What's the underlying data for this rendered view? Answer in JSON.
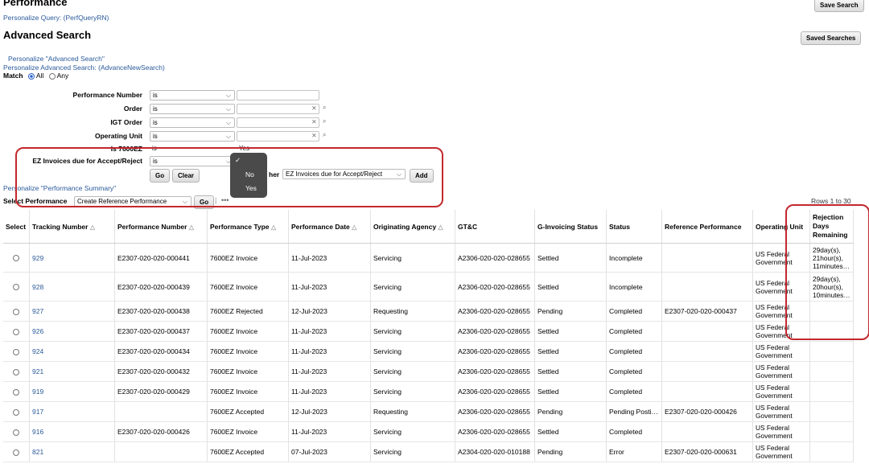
{
  "header": {
    "title": "Performance",
    "save_search": "Save Search",
    "personalize_query": "Personalize Query: (PerfQueryRN)"
  },
  "advanced": {
    "title": "Advanced Search",
    "saved_searches": "Saved Searches",
    "personalize_adv": "Personalize \"Advanced Search\"",
    "personalize_adv_new": "Personalize Advanced Search: (AdvanceNewSearch)",
    "match_label": "Match",
    "match_all": "All",
    "match_any": "Any"
  },
  "criteria": [
    {
      "label": "Performance Number",
      "operator": "is"
    },
    {
      "label": "Order",
      "operator": "is"
    },
    {
      "label": "IGT Order",
      "operator": "is"
    },
    {
      "label": "Operating Unit",
      "operator": "is"
    },
    {
      "label": "Is 7600EZ",
      "operator": "is",
      "value": "Yes"
    },
    {
      "label": "EZ Invoices due for Accept/Reject",
      "operator": "is"
    }
  ],
  "actions": {
    "go": "Go",
    "clear": "Clear",
    "add_another_label": "her",
    "add_field_value": "EZ Invoices due for Accept/Reject",
    "add": "Add"
  },
  "dropdown_popup": {
    "check": "✓",
    "options": [
      "No",
      "Yes"
    ]
  },
  "summary": {
    "personalize": "Personalize \"Performance Summary\"",
    "select_performance_label": "Select Performance",
    "select_performance_value": "Create Reference Performance",
    "go": "Go",
    "more": "•••",
    "rows": "Rows 1 to 30"
  },
  "table": {
    "columns": [
      "Select",
      "Tracking Number",
      "Performance Number",
      "Performance Type",
      "Performance Date",
      "Originating Agency",
      "GT&C",
      "G-Invoicing Status",
      "Status",
      "Reference Performance",
      "Operating Unit",
      "Rejection Days Remaining"
    ],
    "rows": [
      [
        "929",
        "E2307-020-020-000441",
        "7600EZ Invoice",
        "11-Jul-2023",
        "Servicing",
        "A2306-020-020-028655",
        "Settled",
        "Incomplete",
        "",
        "US Federal Government",
        "29day(s), 21hour(s), 11minutes…"
      ],
      [
        "928",
        "E2307-020-020-000439",
        "7600EZ Invoice",
        "11-Jul-2023",
        "Servicing",
        "A2306-020-020-028655",
        "Settled",
        "Incomplete",
        "",
        "US Federal Government",
        "29day(s), 20hour(s), 10minutes…"
      ],
      [
        "927",
        "E2307-020-020-000438",
        "7600EZ Rejected",
        "12-Jul-2023",
        "Requesting",
        "A2306-020-020-028655",
        "Pending",
        "Completed",
        "E2307-020-020-000437",
        "US Federal Government",
        ""
      ],
      [
        "926",
        "E2307-020-020-000437",
        "7600EZ Invoice",
        "11-Jul-2023",
        "Servicing",
        "A2306-020-020-028655",
        "Settled",
        "Completed",
        "",
        "US Federal Government",
        ""
      ],
      [
        "924",
        "E2307-020-020-000434",
        "7600EZ Invoice",
        "11-Jul-2023",
        "Servicing",
        "A2306-020-020-028655",
        "Settled",
        "Completed",
        "",
        "US Federal Government",
        ""
      ],
      [
        "921",
        "E2307-020-020-000432",
        "7600EZ Invoice",
        "11-Jul-2023",
        "Servicing",
        "A2306-020-020-028655",
        "Settled",
        "Completed",
        "",
        "US Federal Government",
        ""
      ],
      [
        "919",
        "E2307-020-020-000429",
        "7600EZ Invoice",
        "11-Jul-2023",
        "Servicing",
        "A2306-020-020-028655",
        "Settled",
        "Completed",
        "",
        "US Federal Government",
        ""
      ],
      [
        "917",
        "",
        "7600EZ Accepted",
        "12-Jul-2023",
        "Requesting",
        "A2306-020-020-028655",
        "Pending",
        "Pending Posti…",
        "E2307-020-020-000426",
        "US Federal Government",
        ""
      ],
      [
        "916",
        "E2307-020-020-000426",
        "7600EZ Invoice",
        "11-Jul-2023",
        "Servicing",
        "A2306-020-020-028655",
        "Settled",
        "Completed",
        "",
        "US Federal Government",
        ""
      ],
      [
        "821",
        "",
        "7600EZ Accepted",
        "07-Jul-2023",
        "Servicing",
        "A2304-020-020-010188",
        "Pending",
        "Error",
        "E2307-020-020-000631",
        "US Federal Government",
        ""
      ]
    ]
  },
  "colors": {
    "link": "#2a5a9b",
    "highlight": "#c3282e",
    "popup": "#4a4a4a"
  }
}
